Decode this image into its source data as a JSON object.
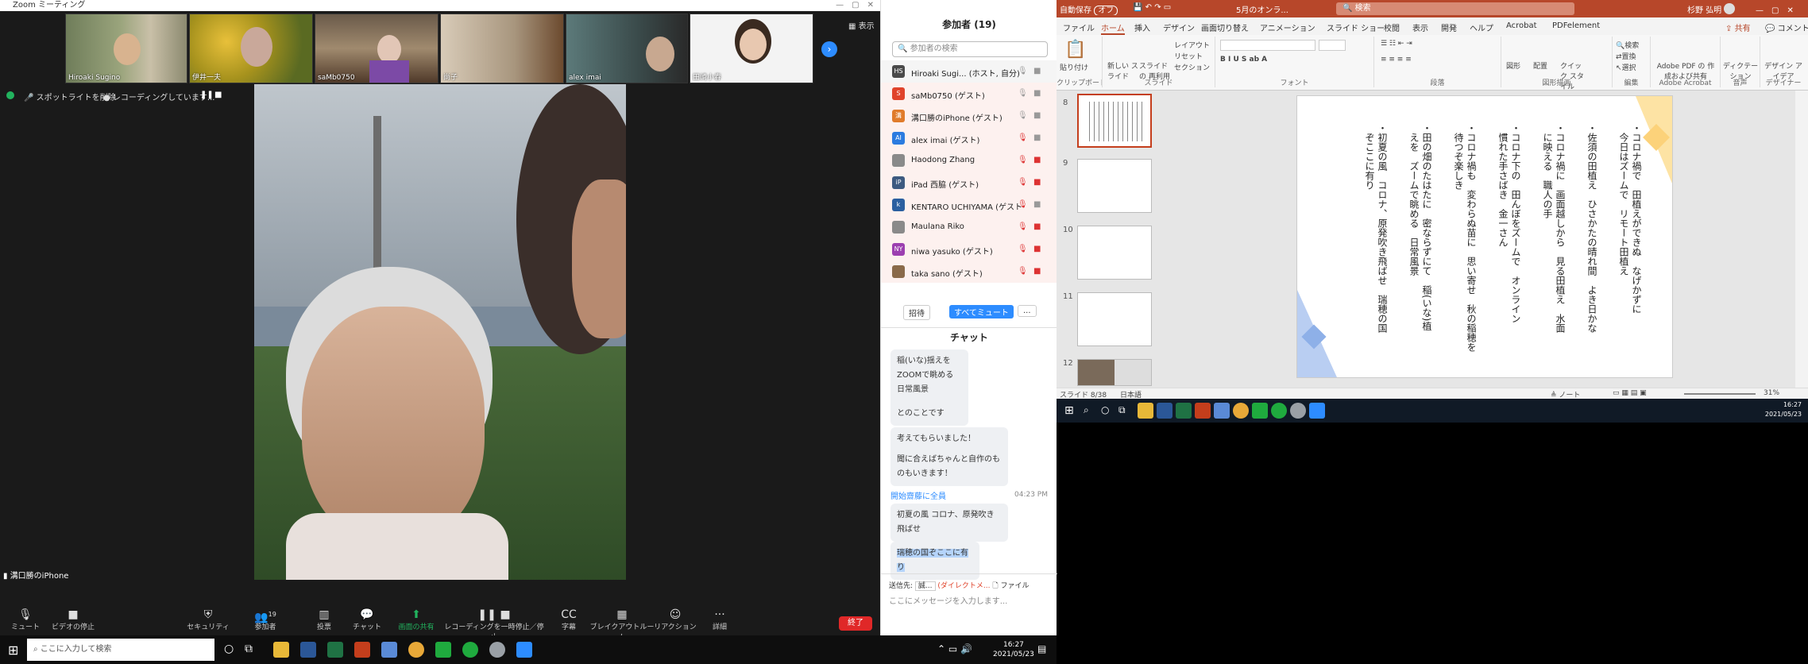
{
  "zoom": {
    "window_title": "Zoom ミーティング",
    "view_label": "表示",
    "gallery": [
      {
        "name": "Hiroaki Sugino"
      },
      {
        "name": "伊井一夫"
      },
      {
        "name": "saMb0750"
      },
      {
        "name": "尚子"
      },
      {
        "name": "alex imai"
      },
      {
        "name": "田崎小春"
      }
    ],
    "spotlight_remove": "スポットライトを削除",
    "recording_status": "レコーディングしています...",
    "speaker_label": "溝口勝のiPhone",
    "toolbar": {
      "mute": "ミュート",
      "video_stop": "ビデオの停止",
      "security": "セキュリティ",
      "participants": "参加者",
      "participants_count": "19",
      "poll": "投票",
      "chat": "チャット",
      "share_screen": "画面の共有",
      "recording_pause": "レコーディングを一時停止／停止",
      "captions": "字幕",
      "breakout": "ブレイクアウトルーム",
      "reactions": "リアクション",
      "more": "詳細",
      "end": "終了"
    }
  },
  "participants_panel": {
    "title": "参加者 (19)",
    "search_placeholder": "参加者の検索",
    "participants": [
      {
        "initials": "HS",
        "name": "Hiroaki Sugi... (ホスト, 自分)",
        "color": "#4a4a4a"
      },
      {
        "initials": "S",
        "name": "saMb0750 (ゲスト)",
        "color": "#e0432b"
      },
      {
        "initials": "溝",
        "name": "溝口勝のiPhone (ゲスト)",
        "color": "#e07b2b"
      },
      {
        "initials": "AI",
        "name": "alex imai (ゲスト)",
        "color": "#2b7be0"
      },
      {
        "initials": "",
        "name": "Haodong Zhang",
        "color": "#8a8a8a"
      },
      {
        "initials": "iP",
        "name": "iPad 西脇 (ゲスト)",
        "color": "#3d5a80"
      },
      {
        "initials": "k",
        "name": "KENTARO UCHIYAMA (ゲスト)",
        "color": "#2b5fa0"
      },
      {
        "initials": "",
        "name": "Maulana Riko",
        "color": "#8a8a8a"
      },
      {
        "initials": "NY",
        "name": "niwa yasuko (ゲスト)",
        "color": "#9c3fb0"
      },
      {
        "initials": "",
        "name": "taka sano (ゲスト)",
        "color": "#8a6a4a"
      }
    ],
    "invite": "招待",
    "mute_all": "すべてミュート",
    "more": "...",
    "chat_title": "チャット",
    "chat_messages": [
      {
        "text1": "稲(いな)揺えを",
        "text2": "ZOOMで眺める",
        "text3": "日常風景",
        "text4": "とのことです"
      },
      {
        "text1": "考えてもらいました！",
        "text2": "聞に合えばちゃんと自作のも",
        "text3": "のもいきます！"
      }
    ],
    "chat_sender": "開始齋藤に全員",
    "chat_time": "04:23 PM",
    "chat_msg3_line1": "初夏の風 コロナ、原発吹き",
    "chat_msg3_line2": "飛ばせ",
    "chat_msg4": "瑞穂の国ぞここに有り",
    "send_to_label": "送信先:",
    "send_to_value": "誠...",
    "direct_label": "(ダイレクトメ...",
    "file_label": "ファイル",
    "input_placeholder": "ここにメッセージを入力します..."
  },
  "powerpoint": {
    "autosave": "自動保存",
    "autosave_state": "オフ",
    "file_title": "5月のオンラ...",
    "search_placeholder": "検索",
    "user": "杉野 弘明",
    "tabs": [
      "ファイル",
      "ホーム",
      "挿入",
      "デザイン",
      "画面切り替え",
      "アニメーション",
      "スライド ショー",
      "校閲",
      "表示",
      "開発",
      "ヘルプ",
      "Acrobat",
      "PDFelement"
    ],
    "share": "共有",
    "comments": "コメント",
    "groups": [
      "クリップボード",
      "スライド",
      "フォント",
      "段落",
      "図形描画",
      "編集",
      "Adobe Acrobat",
      "音声",
      "デザイナー"
    ],
    "ribbon_buttons": {
      "paste": "貼り付け",
      "new_slide": "新しい スライド",
      "reuse": "スライドの 再利用",
      "layout": "レイアウト",
      "reset": "リセット",
      "section": "セクション",
      "shape": "図形",
      "arrange": "配置",
      "quick_style": "クイック スタイル",
      "find": "検索",
      "replace": "置換",
      "select": "選択",
      "adobe_pdf": "Adobe PDF の 作成および共有",
      "dictate": "ディクテー ション",
      "designer": "デザイン アイデア"
    },
    "slide_numbers": [
      "8",
      "9",
      "10",
      "11",
      "12"
    ],
    "slide_columns": [
      "コロナ禍で　田植えができぬ　なげかずに",
      "今日はズームで　リモート田植え",
      "佐須の田植え　ひさかたの晴れ間　よき日かな",
      "コロナ禍に　画面越しから　見る田植え　水面",
      "に映える　職人の手",
      "コロナ下の　田んぼをズームで　オンライン",
      "慣れた手さばき　金一さん",
      "コロナ禍も　変わらぬ苗に　思い寄せ　秋の稲穂を",
      "待つぞ楽しき",
      "田の畑のたはたに　密ならずにて　稲(いな)植",
      "えを　ズームで眺める　日常風景",
      "初夏の風　コロナ、原発吹き飛ばせ　瑞穂の国",
      "ぞここに有り"
    ],
    "status_slide": "スライド 8/38",
    "status_lang": "日本語",
    "status_notes": "ノート",
    "zoom_pct": "31%",
    "clock_time": "16:27",
    "clock_date": "2021/05/23"
  },
  "windows": {
    "search_placeholder": "ここに入力して検索",
    "time": "16:27",
    "date": "2021/05/23"
  }
}
